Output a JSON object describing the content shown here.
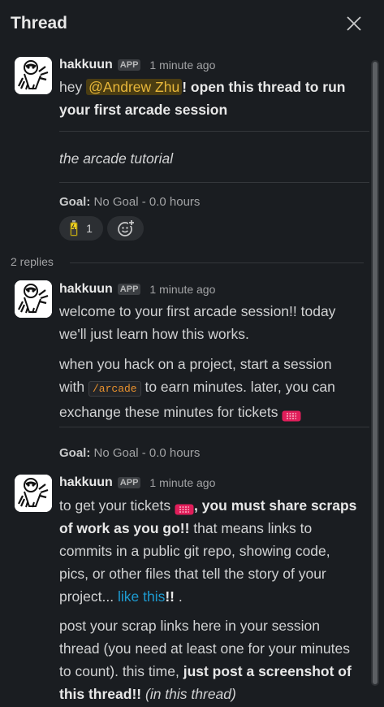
{
  "header": {
    "title": "Thread"
  },
  "messages": [
    {
      "username": "hakkuun",
      "badge": "APP",
      "time": "1 minute ago",
      "line1_pre": "hey ",
      "mention": "@Andrew Zhu",
      "line1_bold": "! open this thread to run",
      "line2_bold": "your first arcade session",
      "subtitle": "the arcade tutorial",
      "goal_label": "Goal:",
      "goal_value": " No Goal - 0.0 hours",
      "reaction_count": "1"
    },
    {
      "username": "hakkuun",
      "badge": "APP",
      "time": "1 minute ago",
      "p1_l1": "welcome to your first arcade session!! today",
      "p1_l2": "we'll just learn how this works.",
      "p2_l1": "when you hack on a project, start a session",
      "p2_l2_pre": "with ",
      "p2_code": "/arcade",
      "p2_l2_post": " to earn minutes. later, you can",
      "p2_l3": "exchange these minutes for tickets ",
      "goal_label": "Goal:",
      "goal_value": " No Goal - 0.0 hours"
    },
    {
      "username": "hakkuun",
      "badge": "APP",
      "time": "1 minute ago",
      "p1_l1_pre": "to get your tickets ",
      "p1_l1_bold": ", you must share scraps",
      "p1_l2_bold": "of work as you go!!",
      "p1_l2_post": " that means links to",
      "p1_l3": "commits in a public git repo, showing code,",
      "p1_l4": "pics, or other files that tell the story of your",
      "p1_l5_pre": "project... ",
      "p1_l5_link": "like this",
      "p1_l5_bold": "!!",
      "p1_l5_post": " .",
      "p2_l1": "post your scrap links here in your session",
      "p2_l2": "thread (you need at least one for your minutes",
      "p2_l3_pre": "to count). this time, ",
      "p2_l3_bold": "just post a screenshot of",
      "p2_l4_bold": "this thread!!",
      "p2_l4_italic": " (in this thread)"
    }
  ],
  "thread": {
    "replies_label": "2 replies"
  },
  "icons": {
    "close": "close-icon",
    "reaction": "battery-icon",
    "add_reaction": "add-reaction-icon",
    "ticket": "ticket-icon"
  },
  "colors": {
    "background": "#1a1d21",
    "mention": "#e8b73a",
    "link": "#1d9bd1",
    "code": "#e8912d",
    "ticket": "#e01e5a"
  }
}
